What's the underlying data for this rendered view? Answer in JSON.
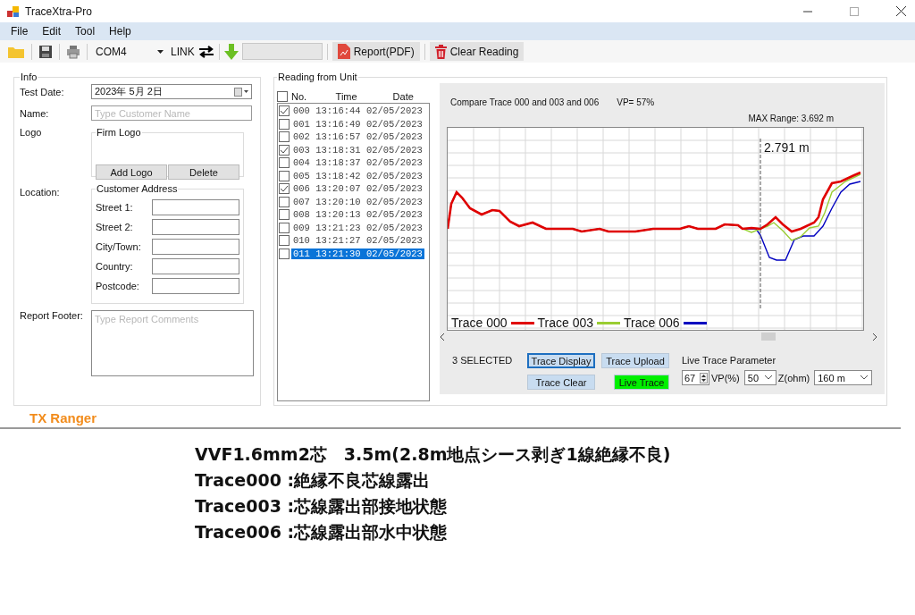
{
  "window": {
    "title": "TraceXtra-Pro"
  },
  "menu": [
    {
      "label": "File"
    },
    {
      "label": "Edit"
    },
    {
      "label": "Tool"
    },
    {
      "label": "Help"
    }
  ],
  "toolbar": {
    "port": "COM4",
    "link_label": "LINK",
    "report_button": "Report(PDF)",
    "clear_button": "Clear Reading"
  },
  "info": {
    "title": "Info",
    "test_date_label": "Test Date:",
    "test_date": "2023年 5月 2日",
    "name_label": "Name:",
    "name_placeholder": "Type Customer Name",
    "logo_label": "Logo",
    "firm_logo_title": "Firm Logo",
    "add_logo_button": "Add Logo",
    "delete_button": "Delete",
    "location_label": "Location:",
    "address_title": "Customer Address",
    "address_fields": [
      {
        "label": "Street 1:"
      },
      {
        "label": "Street 2:"
      },
      {
        "label": "City/Town:"
      },
      {
        "label": "Country:"
      },
      {
        "label": "Postcode:"
      }
    ],
    "footer_label": "Report Footer:",
    "footer_placeholder": "Type Report Comments"
  },
  "readings": {
    "title": "Reading from Unit",
    "all_checked": false,
    "columns": [
      "No.",
      "Time",
      "Date"
    ],
    "rows": [
      {
        "no": "000",
        "time": "13:16:44",
        "date": "02/05/2023",
        "checked": true,
        "selected": false
      },
      {
        "no": "001",
        "time": "13:16:49",
        "date": "02/05/2023",
        "checked": false,
        "selected": false
      },
      {
        "no": "002",
        "time": "13:16:57",
        "date": "02/05/2023",
        "checked": false,
        "selected": false
      },
      {
        "no": "003",
        "time": "13:18:31",
        "date": "02/05/2023",
        "checked": true,
        "selected": false
      },
      {
        "no": "004",
        "time": "13:18:37",
        "date": "02/05/2023",
        "checked": false,
        "selected": false
      },
      {
        "no": "005",
        "time": "13:18:42",
        "date": "02/05/2023",
        "checked": false,
        "selected": false
      },
      {
        "no": "006",
        "time": "13:20:07",
        "date": "02/05/2023",
        "checked": true,
        "selected": false
      },
      {
        "no": "007",
        "time": "13:20:10",
        "date": "02/05/2023",
        "checked": false,
        "selected": false
      },
      {
        "no": "008",
        "time": "13:20:13",
        "date": "02/05/2023",
        "checked": false,
        "selected": false
      },
      {
        "no": "009",
        "time": "13:21:23",
        "date": "02/05/2023",
        "checked": false,
        "selected": false
      },
      {
        "no": "010",
        "time": "13:21:27",
        "date": "02/05/2023",
        "checked": false,
        "selected": false
      },
      {
        "no": "011",
        "time": "13:21:30",
        "date": "02/05/2023",
        "checked": false,
        "selected": true
      }
    ]
  },
  "chart": {
    "compare_text": "Compare Trace 000 and 003 and 006",
    "vp_text": "VP= 57%",
    "max_range": "MAX Range: 3.692 m",
    "cursor_label": "2.791 m",
    "legend": [
      {
        "label": "Trace 000",
        "color": "#e00000"
      },
      {
        "label": "Trace 003",
        "color": "#9acd32"
      },
      {
        "label": "Trace 006",
        "color": "#0000c0"
      }
    ]
  },
  "controls": {
    "selected_count": "3 SELECTED",
    "buttons": [
      {
        "label": "Trace Display",
        "kind": "focused"
      },
      {
        "label": "Trace Upload",
        "kind": "normal"
      },
      {
        "label": "Trace Clear",
        "kind": "normal"
      },
      {
        "label": "Live Trace",
        "kind": "live"
      }
    ],
    "live_title": "Live Trace Parameter",
    "vp_value": "67",
    "vp_label": "VP(%)",
    "z_value": "50",
    "z_label": "Z(ohm)",
    "range_value": "160 m"
  },
  "brand": "TX Ranger",
  "notes": [
    "VVF1.6mm2芯　3.5m(2.8m地点シース剥ぎ1線絶縁不良)",
    "Trace000 :絶縁不良芯線露出",
    "Trace003 :芯線露出部接地状態",
    "Trace006 :芯線露出部水中状態"
  ]
}
